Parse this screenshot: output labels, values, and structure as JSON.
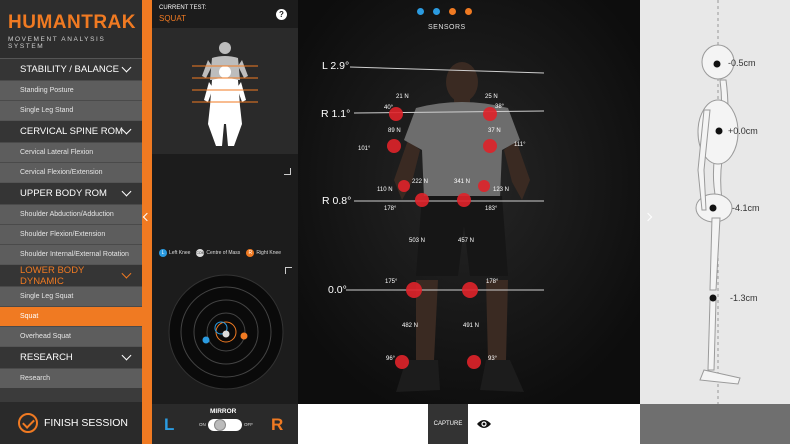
{
  "brand": {
    "name": "HUMANTRAK",
    "tagline": "MOVEMENT ANALYSIS SYSTEM"
  },
  "sidebar": {
    "sections": [
      {
        "label": "STABILITY / BALANCE",
        "active": false,
        "items": [
          {
            "label": "Standing Posture"
          },
          {
            "label": "Single Leg Stand"
          }
        ]
      },
      {
        "label": "CERVICAL SPINE ROM",
        "active": false,
        "items": [
          {
            "label": "Cervical Lateral Flexion"
          },
          {
            "label": "Cervical Flexion/Extension"
          }
        ]
      },
      {
        "label": "UPPER BODY ROM",
        "active": false,
        "items": [
          {
            "label": "Shoulder Abduction/Adduction"
          },
          {
            "label": "Shoulder Flexion/Extension"
          },
          {
            "label": "Shoulder Internal/External Rotation"
          }
        ]
      },
      {
        "label": "LOWER BODY DYNAMIC",
        "active": true,
        "items": [
          {
            "label": "Single Leg Squat"
          },
          {
            "label": "Squat",
            "selected": true
          },
          {
            "label": "Overhead Squat"
          }
        ]
      },
      {
        "label": "RESEARCH",
        "active": false,
        "items": [
          {
            "label": "Research"
          }
        ]
      }
    ],
    "finish_label": "FINISH SESSION"
  },
  "test": {
    "label": "CURRENT TEST:",
    "name": "SQUAT",
    "help": "?"
  },
  "legend": {
    "left_knee": {
      "badge": "L",
      "label": "Left Knee"
    },
    "com": {
      "badge": "COM",
      "label": "Centre of Mass"
    },
    "right_knee": {
      "badge": "R",
      "label": "Right Knee"
    }
  },
  "mirror": {
    "label": "MIRROR",
    "on": "ON",
    "off": "OFF",
    "left": "L",
    "right": "R"
  },
  "capture_label": "CAPTURE",
  "sensors": {
    "title": "SENSORS",
    "colors": [
      "#2b9be0",
      "#2b9be0",
      "#f07a22",
      "#f07a22"
    ]
  },
  "measurements": {
    "head_tilt": "L 2.9°",
    "shoulder_tilt": "R 1.1°",
    "hip_tilt": "R 0.8°",
    "knee_tilt": "0.0°",
    "shoulder_left_force": "21 N",
    "shoulder_right_force": "25 N",
    "shoulder_left_angle": "40°",
    "shoulder_right_angle": "38°",
    "elbow_left_force": "89 N",
    "elbow_right_force": "37 N",
    "elbow_left_angle": "101°",
    "elbow_right_angle": "111°",
    "wrist_left_inner": "222 N",
    "wrist_right_inner": "341 N",
    "wrist_left_outer": "110 N",
    "wrist_right_outer": "123 N",
    "hip_left_angle": "178°",
    "hip_right_angle": "183°",
    "thigh_left_force": "503 N",
    "thigh_right_force": "457 N",
    "knee_left_angle": "175°",
    "knee_right_angle": "178°",
    "shin_left_force": "482 N",
    "shin_right_force": "491 N",
    "ankle_left_angle": "96°",
    "ankle_right_angle": "93°"
  },
  "skeleton": {
    "head": "-0.5cm",
    "thorax": "+0.0cm",
    "pelvis": "-4.1cm",
    "knee": "-1.3cm"
  },
  "colors": {
    "accent": "#f07a22",
    "left": "#2b9be0",
    "right": "#f07a22",
    "sensor_marker": "#e0232a"
  }
}
